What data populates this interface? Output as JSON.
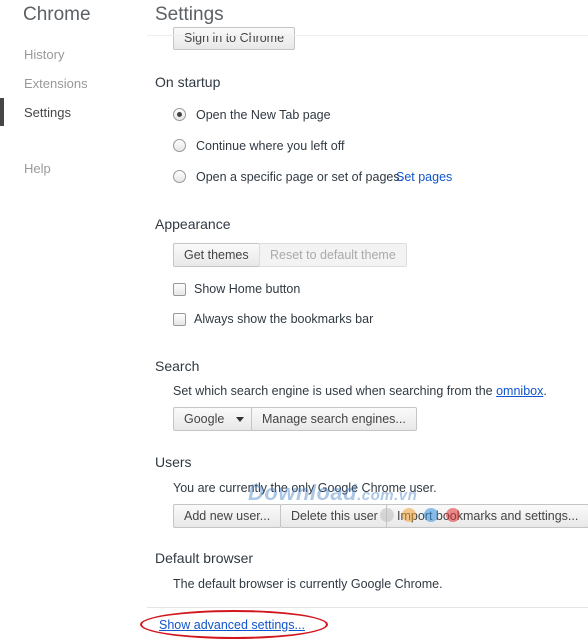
{
  "sidebar": {
    "title": "Chrome",
    "items": [
      {
        "label": "History"
      },
      {
        "label": "Extensions"
      },
      {
        "label": "Settings"
      },
      {
        "label": "Help"
      }
    ]
  },
  "page": {
    "title": "Settings"
  },
  "signin": {
    "button": "Sign in to Chrome"
  },
  "startup": {
    "title": "On startup",
    "options": [
      {
        "label": "Open the New Tab page",
        "selected": true
      },
      {
        "label": "Continue where you left off",
        "selected": false
      },
      {
        "label": "Open a specific page or set of pages.",
        "selected": false
      }
    ],
    "set_pages_link": "Set pages"
  },
  "appearance": {
    "title": "Appearance",
    "get_themes": "Get themes",
    "reset_theme": "Reset to default theme",
    "show_home": "Show Home button",
    "show_bookmarks": "Always show the bookmarks bar"
  },
  "search": {
    "title": "Search",
    "description": "Set which search engine is used when searching from the",
    "omnibox_link": "omnibox",
    "period": ".",
    "engine": "Google",
    "manage": "Manage search engines..."
  },
  "users": {
    "title": "Users",
    "description": "You are currently the only Google Chrome user.",
    "add": "Add new user...",
    "delete": "Delete this user",
    "import": "Import bookmarks and settings..."
  },
  "default_browser": {
    "title": "Default browser",
    "description": "The default browser is currently Google Chrome."
  },
  "advanced_link": "Show advanced settings...",
  "watermark": {
    "text": "Download",
    "suffix": ".com.vn"
  }
}
